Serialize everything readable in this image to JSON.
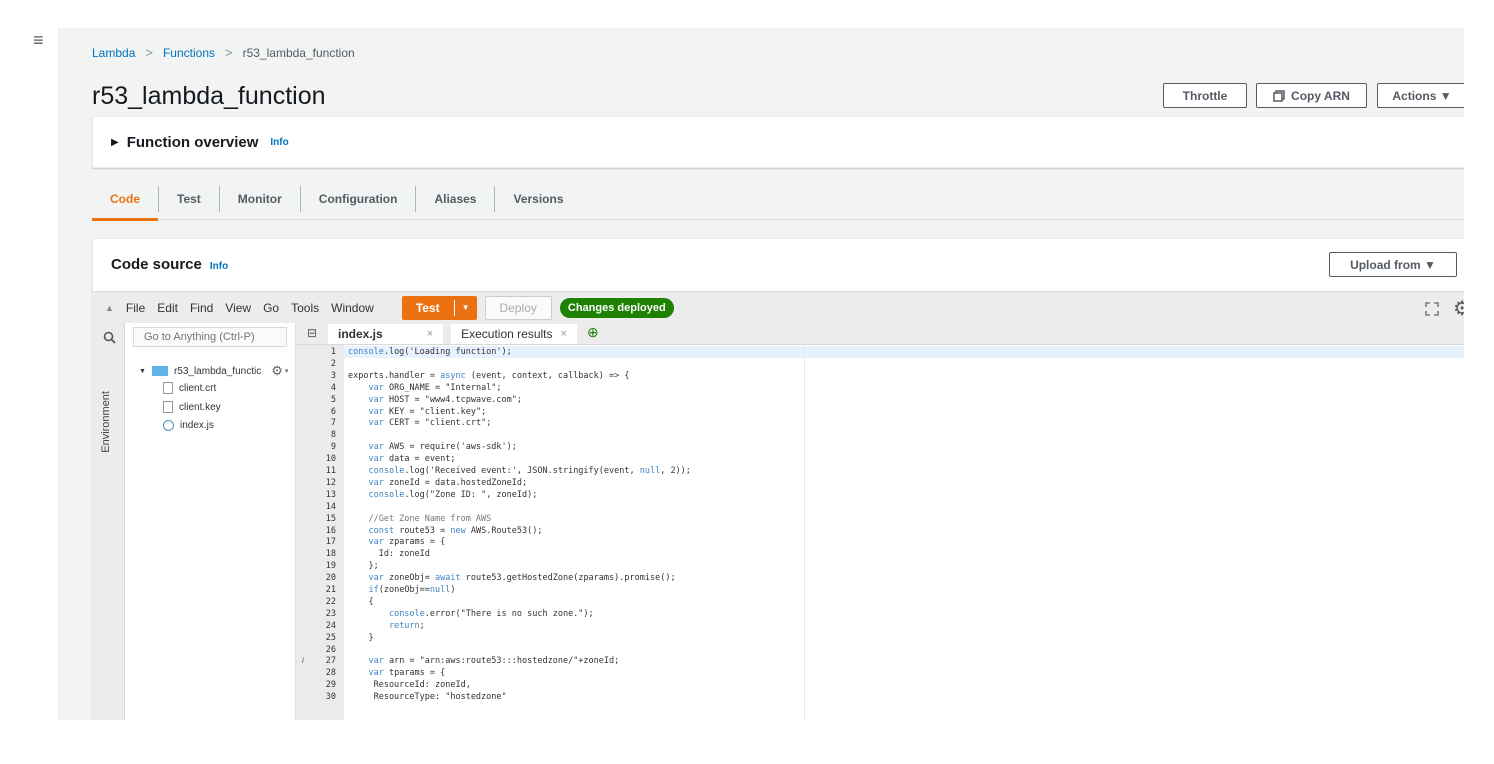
{
  "nav": {
    "menu_icon": "hamburger-icon",
    "menu_glyph": "≡"
  },
  "breadcrumb": {
    "items": [
      "Lambda",
      "Functions",
      "r53_lambda_function"
    ],
    "separator": ">"
  },
  "page": {
    "title": "r53_lambda_function"
  },
  "header_buttons": {
    "throttle": "Throttle",
    "copy_arn": "Copy ARN",
    "actions": "Actions ▼"
  },
  "overview": {
    "title": "Function overview",
    "info": "Info"
  },
  "tabs": [
    "Code",
    "Test",
    "Monitor",
    "Configuration",
    "Aliases",
    "Versions"
  ],
  "active_tab": "Code",
  "code_source": {
    "title": "Code source",
    "info": "Info",
    "upload": "Upload from ▼"
  },
  "ide": {
    "menu": [
      "File",
      "Edit",
      "Find",
      "View",
      "Go",
      "Tools",
      "Window"
    ],
    "test_label": "Test",
    "deploy_label": "Deploy",
    "status": "Changes deployed",
    "goto_placeholder": "Go to Anything (Ctrl-P)",
    "environment_label": "Environment",
    "tree": {
      "folder": "r53_lambda_functic",
      "files": [
        "client.crt",
        "client.key",
        "index.js"
      ]
    },
    "tabs": [
      {
        "label": "index.js",
        "close": "×"
      },
      {
        "label": "Execution results",
        "close": "×"
      }
    ],
    "info_marker": "i",
    "code_lines": [
      "console.log('Loading function');",
      "",
      "exports.handler = async (event, context, callback) => {",
      "    var ORG_NAME = \"Internal\";",
      "    var HOST = \"www4.tcpwave.com\";",
      "    var KEY = \"client.key\";",
      "    var CERT = \"client.crt\";",
      "",
      "    var AWS = require('aws-sdk');",
      "    var data = event;",
      "    console.log('Received event:', JSON.stringify(event, null, 2));",
      "    var zoneId = data.hostedZoneId;",
      "    console.log(\"Zone ID: \", zoneId);",
      "",
      "    //Get Zone Name from AWS",
      "    const route53 = new AWS.Route53();",
      "    var zparams = {",
      "      Id: zoneId",
      "    };",
      "    var zoneObj= await route53.getHostedZone(zparams).promise();",
      "    if(zoneObj==null)",
      "    {",
      "        console.error(\"There is no such zone.\");",
      "        return;",
      "    }",
      "",
      "    var arn = \"arn:aws:route53:::hostedzone/\"+zoneId;",
      "    var tparams = {",
      "     ResourceId: zoneId,",
      "     ResourceType: \"hostedzone\""
    ]
  }
}
